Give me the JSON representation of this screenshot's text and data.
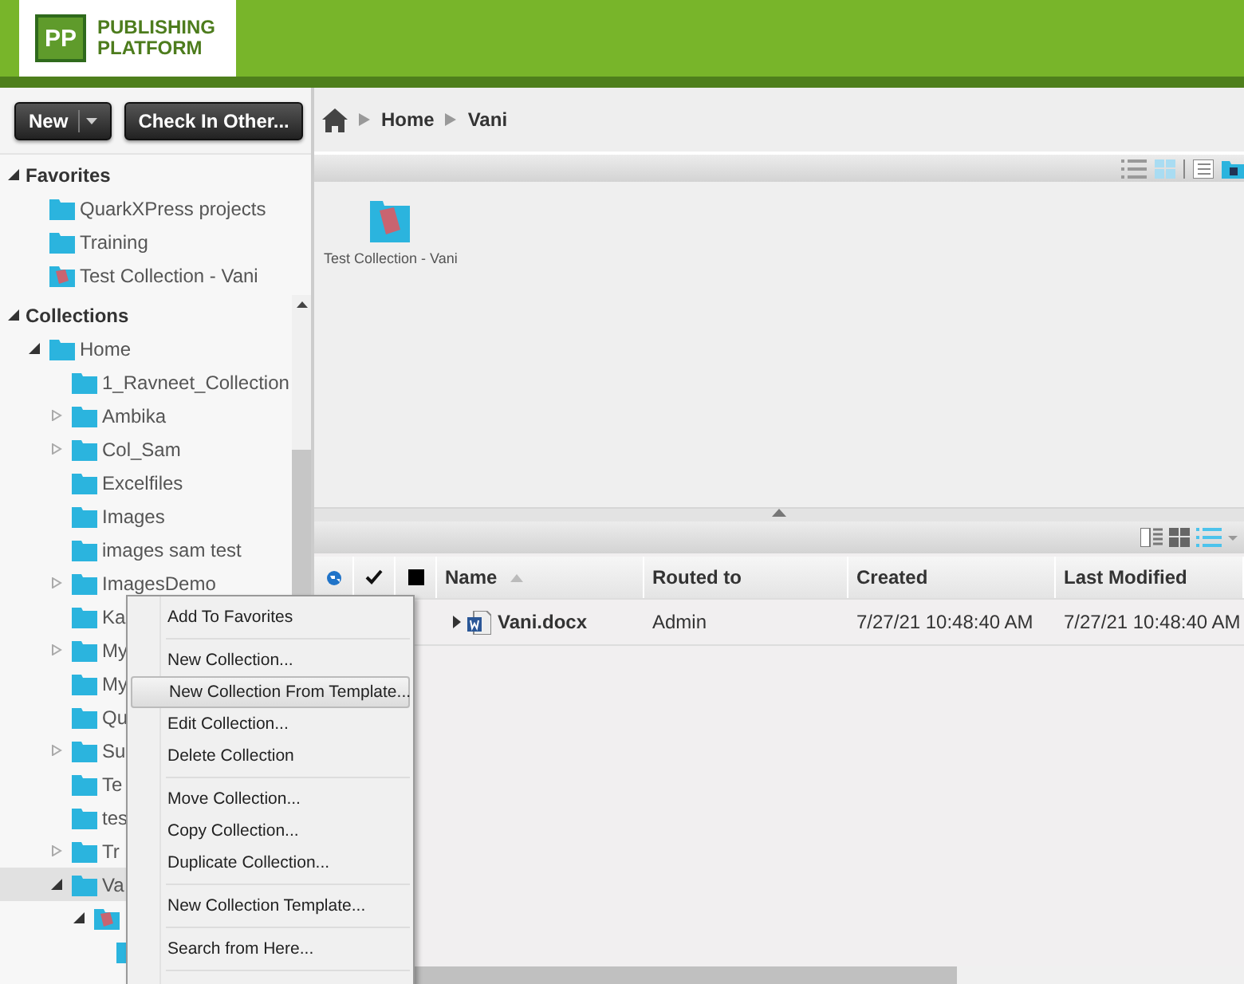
{
  "header": {
    "logo_mark": "PP",
    "logo_lines": [
      "PUBLISHING",
      "PLATFORM"
    ]
  },
  "toolbar": {
    "buttons": [
      {
        "label": "New",
        "dropdown": true
      },
      {
        "label": "Check In Other...",
        "dropdown": false
      }
    ]
  },
  "sidebar": {
    "sections": [
      {
        "title": "Favorites",
        "expanded": true,
        "items": [
          {
            "label": "QuarkXPress projects",
            "kind": "folder",
            "selected": false
          },
          {
            "label": "Training",
            "kind": "folder",
            "selected": false
          },
          {
            "label": "Test Collection - Vani",
            "kind": "collection",
            "selected": false
          }
        ]
      },
      {
        "title": "Collections",
        "expanded": true,
        "items": [
          {
            "label": "Home",
            "kind": "folder",
            "expanded": true,
            "selected": false,
            "children": [
              {
                "label": "1_Ravneet_Collection",
                "kind": "folder",
                "selected": false
              },
              {
                "label": "Ambika",
                "kind": "folder",
                "expanded": false,
                "selected": false
              },
              {
                "label": "Col_Sam",
                "kind": "folder",
                "expanded": false,
                "selected": false
              },
              {
                "label": "Excelfiles",
                "kind": "folder",
                "selected": false
              },
              {
                "label": "Images",
                "kind": "folder",
                "selected": false
              },
              {
                "label": "images sam test",
                "kind": "folder",
                "selected": false
              },
              {
                "label": "ImagesDemo",
                "kind": "folder",
                "expanded": false,
                "selected": false
              },
              {
                "label": "Ka",
                "kind": "folder",
                "selected": false
              },
              {
                "label": "My",
                "kind": "folder",
                "expanded": false,
                "selected": false
              },
              {
                "label": "My",
                "kind": "folder",
                "selected": false
              },
              {
                "label": "Qu",
                "kind": "folder",
                "selected": false
              },
              {
                "label": "Su",
                "kind": "folder",
                "expanded": false,
                "selected": false
              },
              {
                "label": "Te",
                "kind": "folder",
                "selected": false
              },
              {
                "label": "tes",
                "kind": "folder",
                "selected": false
              },
              {
                "label": "Tr",
                "kind": "folder",
                "expanded": false,
                "selected": false
              },
              {
                "label": "Va",
                "kind": "folder",
                "expanded": true,
                "selected": true,
                "children": [
                  {
                    "kind": "collection",
                    "expanded": true,
                    "selected": false,
                    "children": [
                      {
                        "kind": "folder",
                        "selected": false
                      }
                    ]
                  }
                ]
              }
            ]
          }
        ]
      }
    ]
  },
  "breadcrumb": [
    "Home",
    "Vani"
  ],
  "grid": {
    "items": [
      {
        "label": "Test Collection - Vani",
        "kind": "collection"
      }
    ]
  },
  "table": {
    "columns": [
      {
        "kind": "globe"
      },
      {
        "kind": "check"
      },
      {
        "kind": "square"
      },
      {
        "kind": "text",
        "label": "Name",
        "sorted": true
      },
      {
        "kind": "text",
        "label": "Routed to",
        "sorted": false
      },
      {
        "kind": "text",
        "label": "Created",
        "sorted": false
      },
      {
        "kind": "text",
        "label": "Last Modified",
        "sorted": false
      }
    ],
    "rows": [
      {
        "name": "Vani.docx",
        "routed_to": "Admin",
        "created": "7/27/21 10:48:40 AM",
        "last_modified": "7/27/21 10:48:40 AM"
      }
    ]
  },
  "context_menu": {
    "groups": [
      [
        {
          "label": "Add To Favorites",
          "selected": false
        }
      ],
      [
        {
          "label": "New Collection...",
          "selected": false
        },
        {
          "label": "New Collection From Template...",
          "selected": true
        },
        {
          "label": "Edit Collection...",
          "selected": false
        },
        {
          "label": "Delete Collection",
          "selected": false
        }
      ],
      [
        {
          "label": "Move Collection...",
          "selected": false
        },
        {
          "label": "Copy Collection...",
          "selected": false
        },
        {
          "label": "Duplicate Collection...",
          "selected": false
        }
      ],
      [
        {
          "label": "New Collection Template...",
          "selected": false
        }
      ],
      [
        {
          "label": "Search from Here...",
          "selected": false
        }
      ]
    ]
  }
}
